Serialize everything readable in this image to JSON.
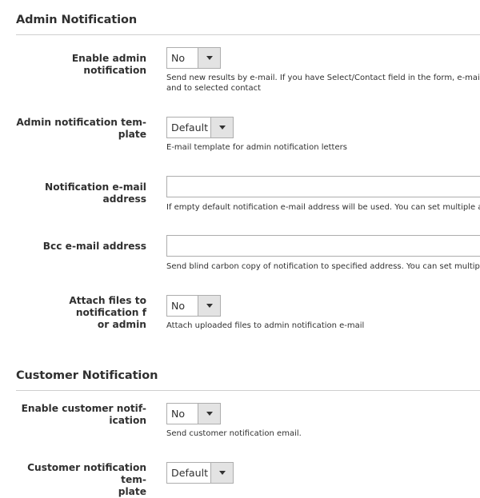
{
  "admin": {
    "section_title": "Admin Notification",
    "enable": {
      "label": "Enable admin notification",
      "value": "No",
      "note_line1": "Send new results by e-mail. If you have Select/Contact field in the form, e-mail notific",
      "note_line2": "and to selected contact"
    },
    "template": {
      "label_line1": "Admin notification tem-",
      "label_line2": "plate",
      "value": "Default",
      "note": "E-mail template for admin notification letters"
    },
    "email": {
      "label": "Notification e-mail address",
      "value": "",
      "note": "If empty default notification e-mail address will be used. You can set multiple addres"
    },
    "bcc": {
      "label": "Bcc e-mail address",
      "value": "",
      "note": "Send blind carbon copy of notification to specified address. You can set multiple add"
    },
    "attach": {
      "label_line1": "Attach files to notification f",
      "label_line2": "or admin",
      "value": "No",
      "note": "Attach uploaded files to admin notification e-mail"
    }
  },
  "customer": {
    "section_title": "Customer Notification",
    "enable": {
      "label_line1": "Enable customer notif-",
      "label_line2": "ication",
      "value": "No",
      "note": "Send customer notification email."
    },
    "template": {
      "label_line1": "Customer notification tem-",
      "label_line2": "plate",
      "value": "Default"
    }
  },
  "icons": {
    "dropdown": "chevron-down-icon"
  }
}
